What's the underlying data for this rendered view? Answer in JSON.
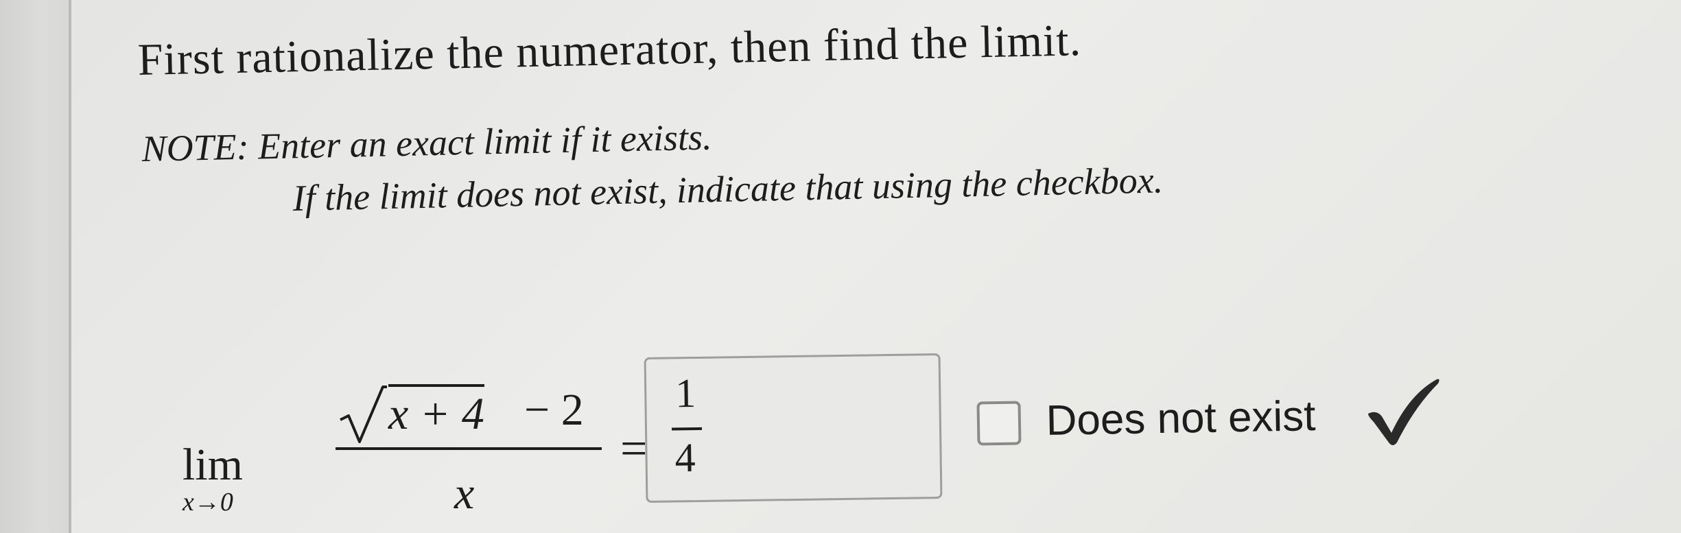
{
  "problem": {
    "instruction": "First rationalize the numerator, then find the limit.",
    "note_line1": "NOTE: Enter an exact limit if it exists.",
    "note_line2": "If the limit does not exist, indicate that using the checkbox."
  },
  "expression": {
    "lim": "lim",
    "lim_sub": "x→0",
    "radicand": "x + 4",
    "minus_term": "− 2",
    "denominator": "x",
    "equals": "="
  },
  "answer": {
    "numerator": "1",
    "denominator": "4"
  },
  "checkbox": {
    "label": "Does not exist",
    "checked": false
  },
  "status": {
    "icon": "checkmark-icon",
    "color": "#2a2a2a"
  }
}
